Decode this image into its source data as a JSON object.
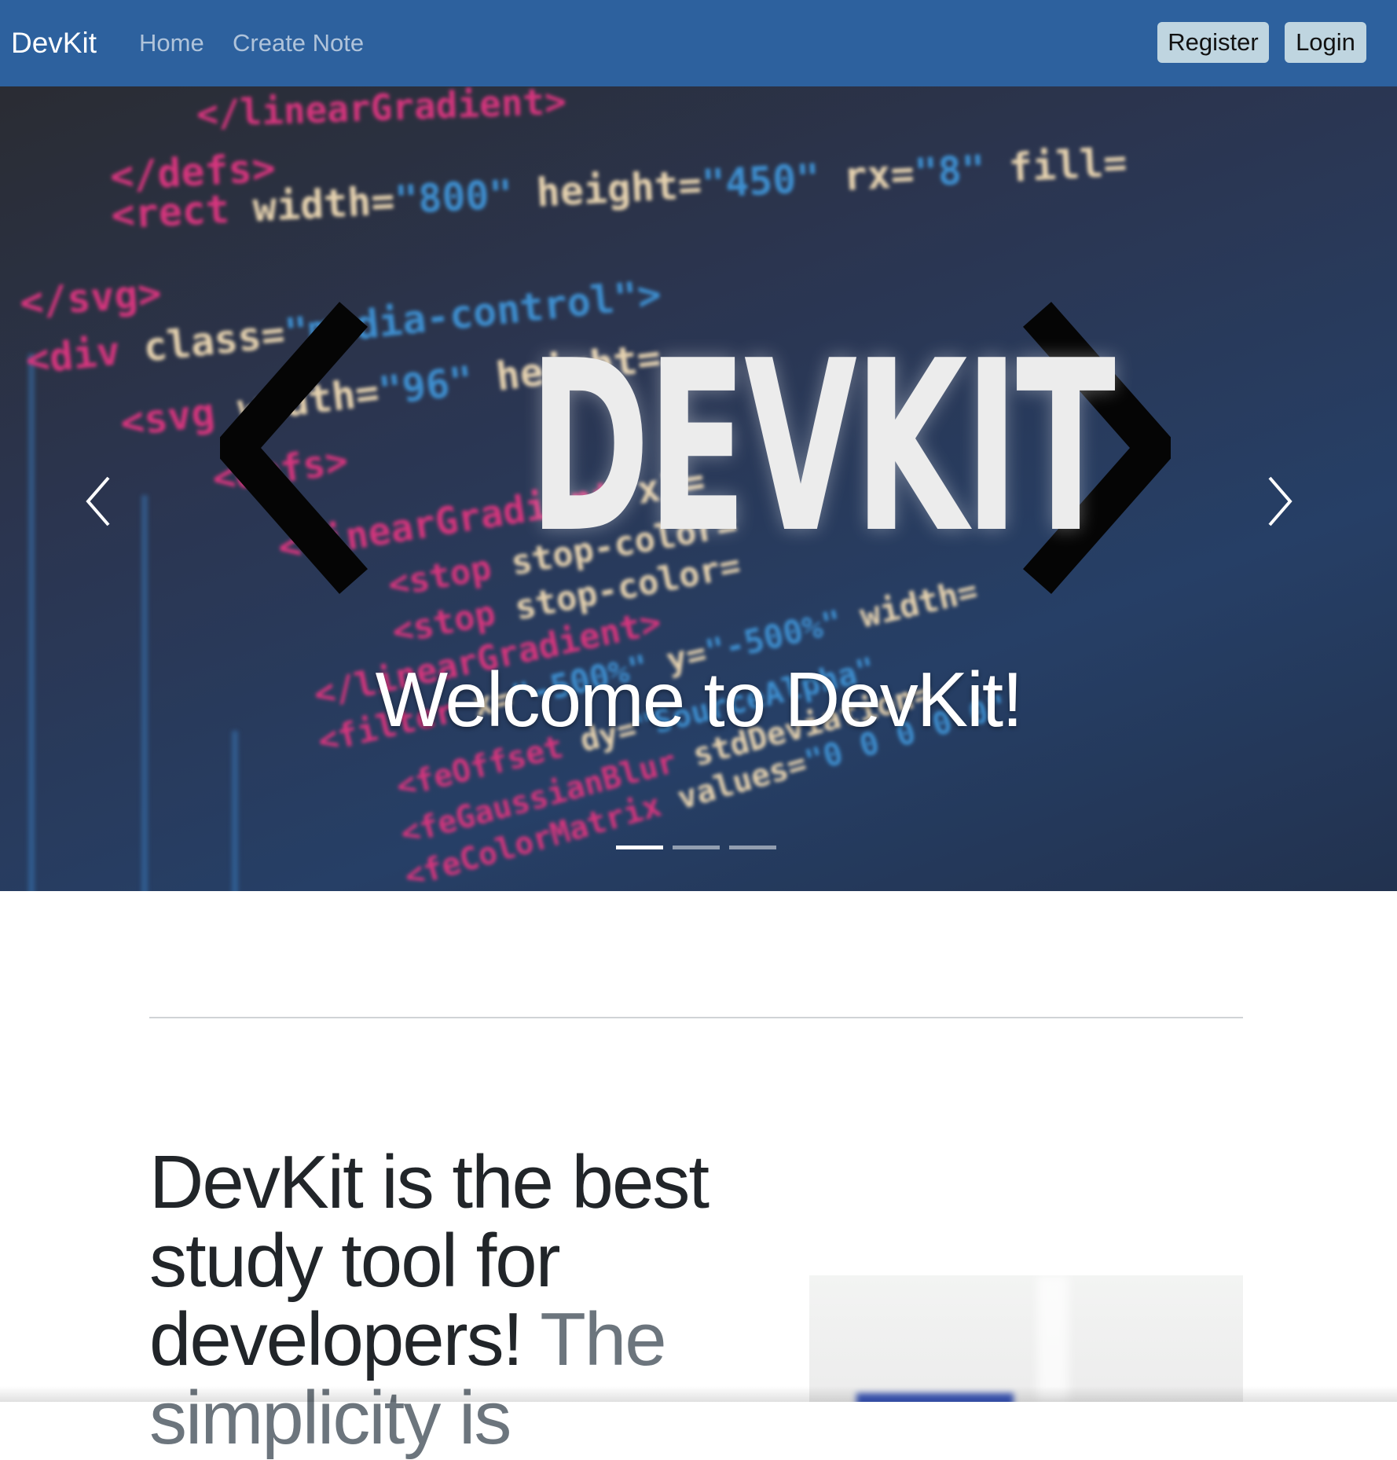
{
  "navbar": {
    "brand": "DevKit",
    "links": [
      "Home",
      "Create Note"
    ],
    "register_label": "Register",
    "login_label": "Login",
    "background_color": "#2d619e"
  },
  "carousel": {
    "logo_word": "DEVKIT",
    "caption": "Welcome to DevKit!",
    "slide_count": 3,
    "active_slide": 1,
    "code_lines": [
      {
        "t": "</linearGradient>",
        "c": "pk"
      },
      {
        "t": "</defs>",
        "c": "pk"
      },
      {
        "t": "<rect",
        "c": "pk"
      },
      {
        "t": " width=",
        "c": "be"
      },
      {
        "t": "\"800\"",
        "c": "bl"
      },
      {
        "t": " height=",
        "c": "be"
      },
      {
        "t": "\"450\"",
        "c": "bl"
      },
      {
        "t": " rx=",
        "c": "be"
      },
      {
        "t": "\"8\"",
        "c": "bl"
      },
      {
        "t": " fill=",
        "c": "be"
      },
      {
        "t": "</svg>",
        "c": "pk"
      },
      {
        "t": "<div",
        "c": "pk"
      },
      {
        "t": " class=",
        "c": "be"
      },
      {
        "t": "\"media-control\">",
        "c": "bl"
      },
      {
        "t": "<svg",
        "c": "pk"
      },
      {
        "t": " width=",
        "c": "be"
      },
      {
        "t": "\"96\"",
        "c": "bl"
      },
      {
        "t": " height=",
        "c": "be"
      },
      {
        "t": "<defs>",
        "c": "pk"
      },
      {
        "t": "<linearGradient",
        "c": "pk"
      },
      {
        "t": " x1=",
        "c": "be"
      },
      {
        "t": "<stop",
        "c": "pk"
      },
      {
        "t": " stop-color=",
        "c": "be"
      },
      {
        "t": "<stop",
        "c": "pk"
      },
      {
        "t": " stop-color=",
        "c": "be"
      },
      {
        "t": "</linearGradient>",
        "c": "pk"
      },
      {
        "t": "<filter",
        "c": "pk"
      },
      {
        "t": " x=",
        "c": "be"
      },
      {
        "t": "\"-500%\"",
        "c": "bl"
      },
      {
        "t": " y=",
        "c": "be"
      },
      {
        "t": "\"-500%\"",
        "c": "bl"
      },
      {
        "t": " width=",
        "c": "be"
      },
      {
        "t": "<feOffset",
        "c": "pk"
      },
      {
        "t": " dy=",
        "c": "be"
      },
      {
        "t": "\"SourceAlpha\"",
        "c": "bl"
      },
      {
        "t": "<feGaussianBlur",
        "c": "pk"
      },
      {
        "t": " stdDeviation=",
        "c": "be"
      },
      {
        "t": "<feColorMatrix",
        "c": "pk"
      },
      {
        "t": " values=",
        "c": "be"
      },
      {
        "t": "\"0 0 0 0 0\"",
        "c": "bl"
      }
    ]
  },
  "featurette": {
    "heading": "DevKit is the best study tool for developers!",
    "heading_muted": "The simplicity is"
  }
}
